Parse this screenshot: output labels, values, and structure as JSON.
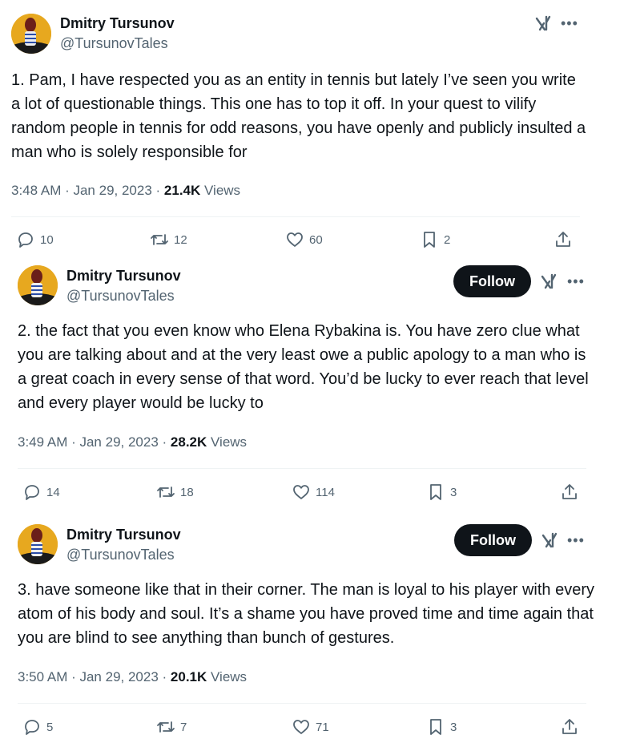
{
  "tweets": [
    {
      "author": "Dmitry Tursunov",
      "handle": "@TursunovTales",
      "follow_label": "",
      "text": "1. Pam, I have respected you as an entity in tennis but lately I’ve seen you write a lot of questionable things. This one has to top it off. In your quest to vilify random people in tennis for odd reasons, you have openly and publicly insulted a man who is solely responsible for",
      "time": "3:48 AM · Jan 29, 2023 · ",
      "views_count": "21.4K",
      "views_label": "Views",
      "replies": "10",
      "reposts": "12",
      "likes": "60",
      "bookmarks": "2"
    },
    {
      "author": "Dmitry Tursunov",
      "handle": "@TursunovTales",
      "follow_label": "Follow",
      "text": "2. the fact that you even know who Elena Rybakina is. You have zero clue what you are talking about and at the very least owe a public apology to a man who is a great coach in every sense of that word. You’d be lucky to ever reach that level and every player would be lucky to",
      "time": "3:49 AM · Jan 29, 2023 · ",
      "views_count": "28.2K",
      "views_label": "Views",
      "replies": "14",
      "reposts": "18",
      "likes": "114",
      "bookmarks": "3"
    },
    {
      "author": "Dmitry Tursunov",
      "handle": "@TursunovTales",
      "follow_label": "Follow",
      "text": "3. have someone like that in their corner. The man is loyal to his player with every atom of his body and soul. It’s a shame you have proved time and time again that you are blind to see anything than bunch of gestures.",
      "time": "3:50 AM · Jan 29, 2023 · ",
      "views_count": "20.1K",
      "views_label": "Views",
      "replies": "5",
      "reposts": "7",
      "likes": "71",
      "bookmarks": "3"
    }
  ],
  "icons": {
    "reply": "reply-icon",
    "repost": "repost-icon",
    "like": "heart-icon",
    "bookmark": "bookmark-icon",
    "share": "share-icon",
    "grok": "grok-icon",
    "more": "more-icon"
  },
  "colors": {
    "text": "#0f1419",
    "secondary": "#536471",
    "follow_bg": "#0f1419",
    "divider": "#eff3f4",
    "avatar_bg": "#e7a81f"
  }
}
